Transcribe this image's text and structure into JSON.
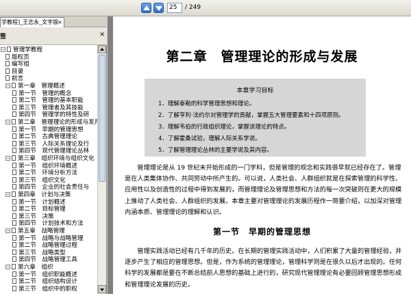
{
  "toolbar": {
    "current_page": "25",
    "page_total": "/ 249"
  },
  "tab": {
    "label": "学教程]_王志永_文字版",
    "close": "×"
  },
  "panel": {
    "label": "签",
    "close": "×"
  },
  "tree": [
    {
      "label": "管理学教程",
      "level": 0,
      "toggle": "−"
    },
    {
      "label": "版权页",
      "level": 1
    },
    {
      "label": "编写组",
      "level": 1
    },
    {
      "label": "目录",
      "level": 1
    },
    {
      "label": "前言",
      "level": 1
    },
    {
      "label": "第一章　管理概述",
      "level": 1,
      "toggle": "−"
    },
    {
      "label": "第一节　管理的概念",
      "level": 2
    },
    {
      "label": "第二节　管理的基本职能",
      "level": 2
    },
    {
      "label": "第三节　管理者及其技能",
      "level": 2
    },
    {
      "label": "第四节　管理学的特性及研",
      "level": 2
    },
    {
      "label": "第二章　管理理论的形成与发月",
      "level": 1,
      "toggle": "−"
    },
    {
      "label": "第一节　早期的管理思想",
      "level": 2
    },
    {
      "label": "第二节　古典管理理论",
      "level": 2
    },
    {
      "label": "第三节　人际关系理论及行",
      "level": 2
    },
    {
      "label": "第四节　现代管理理论丛林",
      "level": 2
    },
    {
      "label": "第三章　组织环境与组织文化",
      "level": 1,
      "toggle": "−"
    },
    {
      "label": "第一节　组织环境概述",
      "level": 2
    },
    {
      "label": "第二节　环境分析方法",
      "level": 2
    },
    {
      "label": "第三节　组织文化",
      "level": 2
    },
    {
      "label": "第四节　企业的社会责任与",
      "level": 2
    },
    {
      "label": "第四章　计划与决策",
      "level": 1,
      "toggle": "−"
    },
    {
      "label": "第一节　计划概述",
      "level": 2
    },
    {
      "label": "第二节　目标管理",
      "level": 2
    },
    {
      "label": "第三节　决策",
      "level": 2
    },
    {
      "label": "第四节　计划技术和方法",
      "level": 2
    },
    {
      "label": "第五章　战略管理",
      "level": 1,
      "toggle": "−"
    },
    {
      "label": "第一节　战略与战略管理",
      "level": 2
    },
    {
      "label": "第二节　战略管理过程",
      "level": 2
    },
    {
      "label": "第三节　战略类型",
      "level": 2
    },
    {
      "label": "第四节　战略管理工具",
      "level": 2
    },
    {
      "label": "第六章　组织",
      "level": 1,
      "toggle": "−"
    },
    {
      "label": "第一节　组织职能概述",
      "level": 2
    },
    {
      "label": "第二节　组织结构设计",
      "level": 2
    },
    {
      "label": "第三节　组织中的职权",
      "level": 2
    }
  ],
  "document": {
    "chapter_title": "第二章　管理理论的形成与发展",
    "goals_title": "本章学习目标",
    "goals": [
      "1．理解泰勒的科学管理思想和理论。",
      "2．了解亨利·法约尔对管理学的贡献，掌握五大管理要素和十四项原则。",
      "3．理解韦伯的行政组织理论，掌握该理论的特点。",
      "4．了解霍桑试验，理解人际关系学说。",
      "5．了解管理理论丛林的主要学说及其内容。"
    ],
    "intro": "管理理论是从 19 世纪末开始形成的一门学科，但是管理的观念和实践很早就已经存在了。管理是在人类集体协作、共同劳动中所产生的。可以说，人类社会、人群组织就是在探索管理的科学性、应用性以及创造性的过程中得到发展的，而管理理论及管理思想和方法的每一次突破则在更大的规模上推动了人类社会、人群组织的发展。本章主要对管理理论的发展历程作一简要介绍，以加深对管理内涵本质、管理理论的理解和认识。",
    "section_title": "第一节　早期的管理思想",
    "section_para": "管理实践活动已经有几千年的历史。在长期的管理实践活动中，人们积累了大量的管理经验，并逐步产生了相应的管理思想。但是，作为系统的管理理论，管理科学则是在很久以后才出现的。任何科学的发展都是要在不断总结前人思想的基础上进行的，研究现代管理理论有必要回顾管理思想形成和管理理论发展的历史。"
  }
}
